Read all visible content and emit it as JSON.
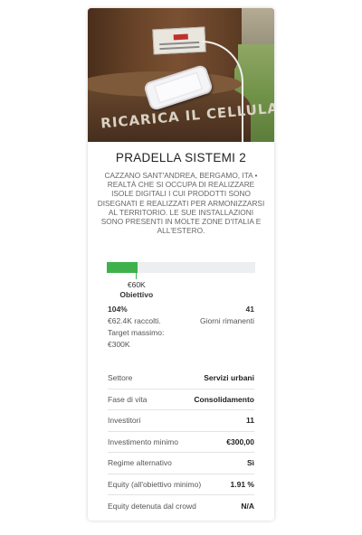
{
  "project": {
    "image_alt": "Stazione di ricarica",
    "image_text": "RICARICA IL CELLULA",
    "title": "PRADELLA SISTEMI 2",
    "description": "CAZZANO SANT'ANDREA, BERGAMO, ITA • REALTÀ CHE SI OCCUPA DI REALIZZARE ISOLE DIGITALI I CUI PRODOTTI SONO DISEGNATI E REALIZZATI PER ARMONIZZARSI AL TERRITORIO. LE SUE INSTALLAZIONI SONO PRESENTI IN MOLTE ZONE D'ITALIA E ALL'ESTERO."
  },
  "funding": {
    "progress_fraction": 0.21,
    "target_fraction": 0.2,
    "target_amount": "€60K",
    "target_label": "Obiettivo",
    "percent": "104%",
    "raised": "€62.4K raccolti.",
    "days_count": "41",
    "days_label": "Giorni rimanenti",
    "max_target_label": "Target massimo:",
    "max_target_value": "€300K",
    "bar_color": "#3eb14b"
  },
  "details": [
    {
      "label": "Settore",
      "value": "Servizi urbani"
    },
    {
      "label": "Fase di vita",
      "value": "Consolidamento"
    },
    {
      "label": "Investitori",
      "value": "11"
    },
    {
      "label": "Investimento minimo",
      "value": "€300,00"
    },
    {
      "label": "Regime alternativo",
      "value": "Sì"
    },
    {
      "label": "Equity (all'obiettivo minimo)",
      "value": "1.91 %"
    },
    {
      "label": "Equity detenuta dal crowd",
      "value": "N/A"
    }
  ]
}
